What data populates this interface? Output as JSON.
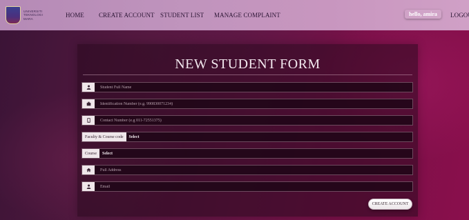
{
  "navbar": {
    "logo_text": [
      "UNIVERSITI",
      "TEKNOLOGI",
      "MARA"
    ],
    "items": [
      {
        "label": "HOME"
      },
      {
        "label": "CREATE ACCOUNT"
      },
      {
        "label": "STUDENT LIST"
      },
      {
        "label": "MANAGE COMPLAINT"
      }
    ],
    "greeting": "hello, amira",
    "logout": "LOGOU"
  },
  "form": {
    "title": "NEW STUDENT FORM",
    "fields": {
      "full_name": {
        "placeholder": "Student Full Name",
        "icon": "user-icon"
      },
      "ic_number": {
        "placeholder": "Identification Number (e.g. 990830071234)",
        "icon": "id-card-icon"
      },
      "contact": {
        "placeholder": "Contact Number (e.g 011-72551375)",
        "icon": "phone-icon"
      },
      "faculty": {
        "label": "Faculty & Course code",
        "value": "Select"
      },
      "course": {
        "label": "Course",
        "value": "Select"
      },
      "address": {
        "placeholder": "Full Address",
        "icon": "home-icon"
      },
      "email": {
        "placeholder": "Email",
        "icon": "user-icon"
      }
    },
    "submit_label": "CREATE ACCOUNT"
  },
  "colors": {
    "navbar": "#c094bd",
    "background": "#6a1446",
    "card": "#280a1e"
  }
}
